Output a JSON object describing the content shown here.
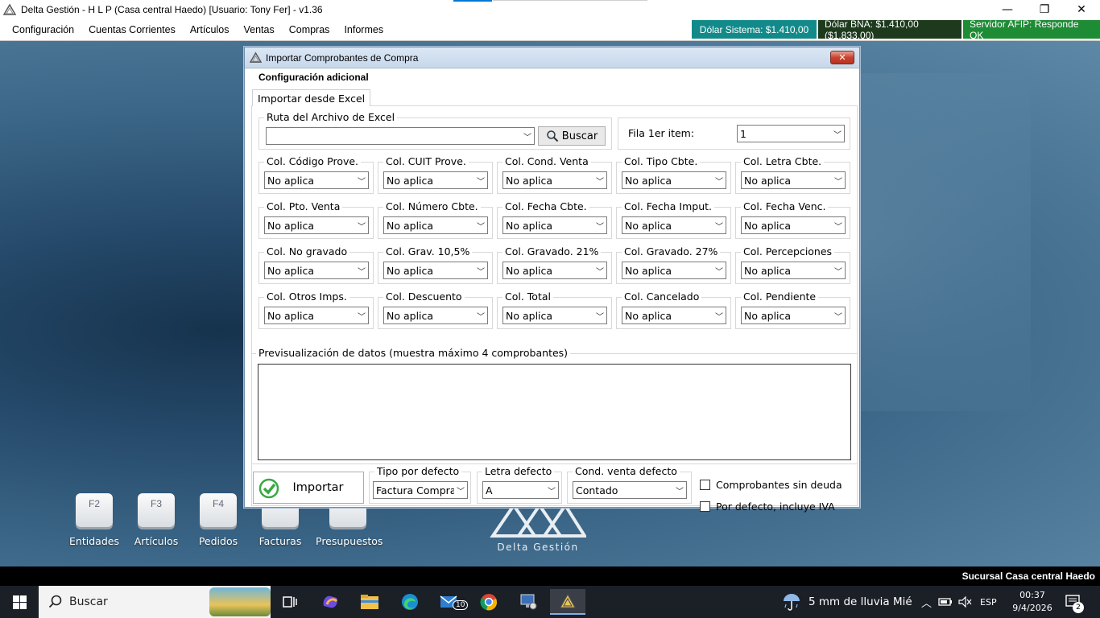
{
  "window": {
    "title": "Delta Gestión - H L P (Casa central Haedo) [Usuario: Tony Fer] - v1.36",
    "controls": {
      "minimize": "—",
      "restore": "❐",
      "close": "✕"
    }
  },
  "menu": {
    "items": [
      "Configuración",
      "Cuentas Corrientes",
      "Artículos",
      "Ventas",
      "Compras",
      "Informes"
    ]
  },
  "status": {
    "dolar_sistema": "Dólar Sistema: $1.410,00",
    "dolar_bna": "Dólar BNA: $1.410,00 ($1.833,00)",
    "servidor_afip": "Servidor AFIP:  Responde OK"
  },
  "desktop": {
    "fkeys": [
      {
        "key": "F2",
        "label": "Entidades"
      },
      {
        "key": "F3",
        "label": "Artículos"
      },
      {
        "key": "F4",
        "label": "Pedidos"
      },
      {
        "key": "",
        "label": "Facturas"
      },
      {
        "key": "",
        "label": "Presupuestos"
      }
    ],
    "logo_text": "Delta Gestión"
  },
  "dialog": {
    "title": "Importar Comprobantes de Compra",
    "close_label": "✕",
    "config_tab": "Configuración adicional",
    "excel_tab": "Importar desde Excel",
    "ruta": {
      "legend": "Ruta del Archivo de Excel",
      "value": "",
      "buscar_label": "Buscar"
    },
    "fila": {
      "label": "Fila 1er item:",
      "value": "1"
    },
    "columns": [
      {
        "label": "Col. Código Prove.",
        "value": "No aplica"
      },
      {
        "label": "Col. CUIT Prove.",
        "value": "No aplica"
      },
      {
        "label": "Col. Cond. Venta",
        "value": "No aplica"
      },
      {
        "label": "Col. Tipo Cbte.",
        "value": "No aplica"
      },
      {
        "label": "Col. Letra Cbte.",
        "value": "No aplica"
      },
      {
        "label": "Col. Pto. Venta",
        "value": "No aplica"
      },
      {
        "label": "Col. Número Cbte.",
        "value": "No aplica"
      },
      {
        "label": "Col. Fecha Cbte.",
        "value": "No aplica"
      },
      {
        "label": "Col. Fecha Imput.",
        "value": "No aplica"
      },
      {
        "label": "Col. Fecha Venc.",
        "value": "No aplica"
      },
      {
        "label": "Col. No gravado",
        "value": "No aplica"
      },
      {
        "label": "Col. Grav. 10,5%",
        "value": "No aplica"
      },
      {
        "label": "Col. Gravado. 21%",
        "value": "No aplica"
      },
      {
        "label": "Col. Gravado. 27%",
        "value": "No aplica"
      },
      {
        "label": "Col. Percepciones",
        "value": "No aplica"
      },
      {
        "label": "Col. Otros Imps.",
        "value": "No aplica"
      },
      {
        "label": "Col. Descuento",
        "value": "No aplica"
      },
      {
        "label": "Col. Total",
        "value": "No aplica"
      },
      {
        "label": "Col. Cancelado",
        "value": "No aplica"
      },
      {
        "label": "Col. Pendiente",
        "value": "No aplica"
      }
    ],
    "preview": {
      "legend": "Previsualización de datos (muestra máximo 4 comprobantes)"
    },
    "importar_label": "Importar",
    "tipo_defecto": {
      "legend": "Tipo por defecto",
      "value": "Factura Compra"
    },
    "letra_defecto": {
      "legend": "Letra defecto",
      "value": "A"
    },
    "cond_defecto": {
      "legend": "Cond. venta defecto",
      "value": "Contado"
    },
    "chk_sin_deuda": "Comprobantes sin deuda",
    "chk_incluye_iva": "Por defecto, incluye IVA"
  },
  "infostrip": {
    "text": "Sucursal Casa central Haedo"
  },
  "taskbar": {
    "search_placeholder": "Buscar",
    "mail_badge": "10",
    "weather": "5 mm de lluvia Mié",
    "language": "ESP",
    "time": "00:37",
    "date": "9/4/2026",
    "notification_count": "2"
  },
  "colors": {
    "status_sistema": "#138a8a",
    "status_bna": "#1d3a1d",
    "status_afip": "#1e8b35",
    "importar_check": "#3aa845"
  }
}
